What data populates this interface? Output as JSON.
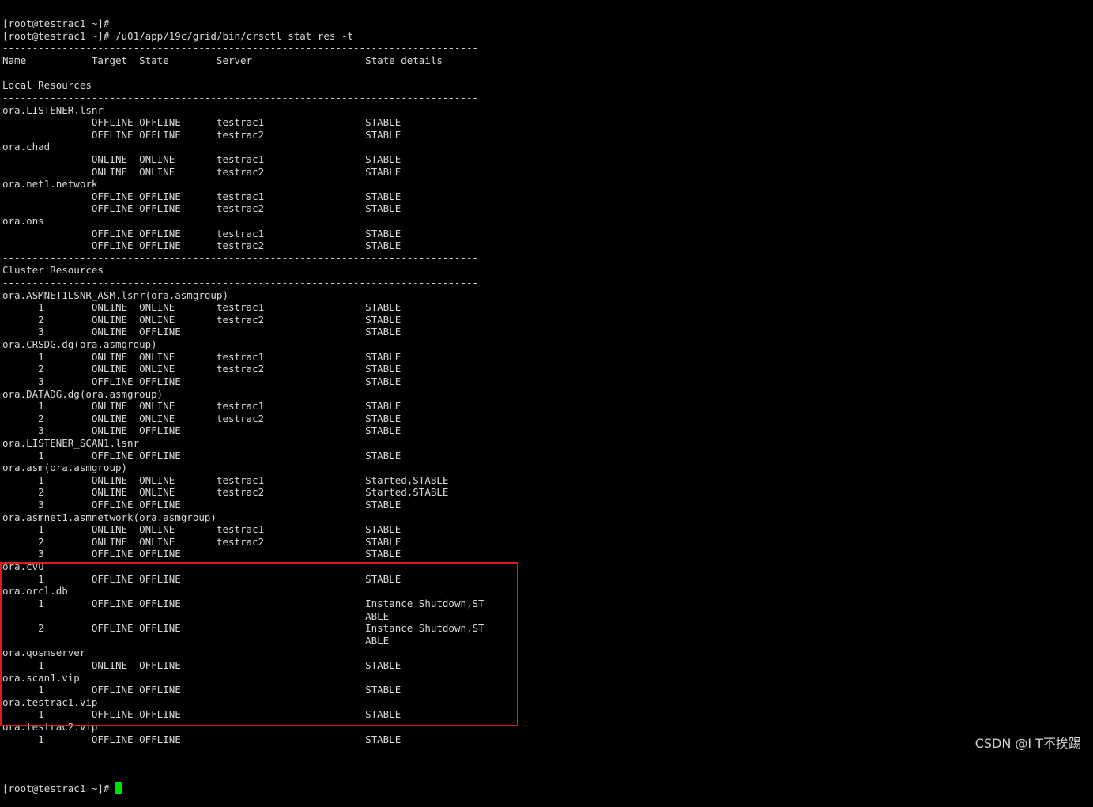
{
  "terminal": {
    "lines": [
      "[root@testrac1 ~]#",
      "[root@testrac1 ~]# /u01/app/19c/grid/bin/crsctl stat res -t",
      "--------------------------------------------------------------------------------",
      "Name           Target  State        Server                   State details",
      "--------------------------------------------------------------------------------",
      "Local Resources",
      "--------------------------------------------------------------------------------",
      "ora.LISTENER.lsnr",
      "               OFFLINE OFFLINE      testrac1                 STABLE",
      "               OFFLINE OFFLINE      testrac2                 STABLE",
      "ora.chad",
      "               ONLINE  ONLINE       testrac1                 STABLE",
      "               ONLINE  ONLINE       testrac2                 STABLE",
      "ora.net1.network",
      "               OFFLINE OFFLINE      testrac1                 STABLE",
      "               OFFLINE OFFLINE      testrac2                 STABLE",
      "ora.ons",
      "               OFFLINE OFFLINE      testrac1                 STABLE",
      "               OFFLINE OFFLINE      testrac2                 STABLE",
      "--------------------------------------------------------------------------------",
      "Cluster Resources",
      "--------------------------------------------------------------------------------",
      "ora.ASMNET1LSNR_ASM.lsnr(ora.asmgroup)",
      "      1        ONLINE  ONLINE       testrac1                 STABLE",
      "      2        ONLINE  ONLINE       testrac2                 STABLE",
      "      3        ONLINE  OFFLINE                               STABLE",
      "ora.CRSDG.dg(ora.asmgroup)",
      "      1        ONLINE  ONLINE       testrac1                 STABLE",
      "      2        ONLINE  ONLINE       testrac2                 STABLE",
      "      3        OFFLINE OFFLINE                               STABLE",
      "ora.DATADG.dg(ora.asmgroup)",
      "      1        ONLINE  ONLINE       testrac1                 STABLE",
      "      2        ONLINE  ONLINE       testrac2                 STABLE",
      "      3        ONLINE  OFFLINE                               STABLE",
      "ora.LISTENER_SCAN1.lsnr",
      "      1        OFFLINE OFFLINE                               STABLE",
      "ora.asm(ora.asmgroup)",
      "      1        ONLINE  ONLINE       testrac1                 Started,STABLE",
      "      2        ONLINE  ONLINE       testrac2                 Started,STABLE",
      "      3        OFFLINE OFFLINE                               STABLE",
      "ora.asmnet1.asmnetwork(ora.asmgroup)",
      "      1        ONLINE  ONLINE       testrac1                 STABLE",
      "      2        ONLINE  ONLINE       testrac2                 STABLE",
      "      3        OFFLINE OFFLINE                               STABLE",
      "ora.cvu",
      "      1        OFFLINE OFFLINE                               STABLE",
      "ora.orcl.db",
      "      1        OFFLINE OFFLINE                               Instance Shutdown,ST",
      "                                                             ABLE",
      "      2        OFFLINE OFFLINE                               Instance Shutdown,ST",
      "                                                             ABLE",
      "ora.qosmserver",
      "      1        ONLINE  OFFLINE                               STABLE",
      "ora.scan1.vip",
      "      1        OFFLINE OFFLINE                               STABLE",
      "ora.testrac1.vip",
      "      1        OFFLINE OFFLINE                               STABLE",
      "ora.testrac2.vip",
      "      1        OFFLINE OFFLINE                               STABLE",
      "--------------------------------------------------------------------------------"
    ],
    "prompt": "[root@testrac1 ~]# "
  },
  "watermark": "CSDN @I T不挨踢",
  "colors": {
    "background": "#000000",
    "text": "#d8d8d8",
    "cursor": "#00e000",
    "highlight_border": "#e01b1b"
  }
}
